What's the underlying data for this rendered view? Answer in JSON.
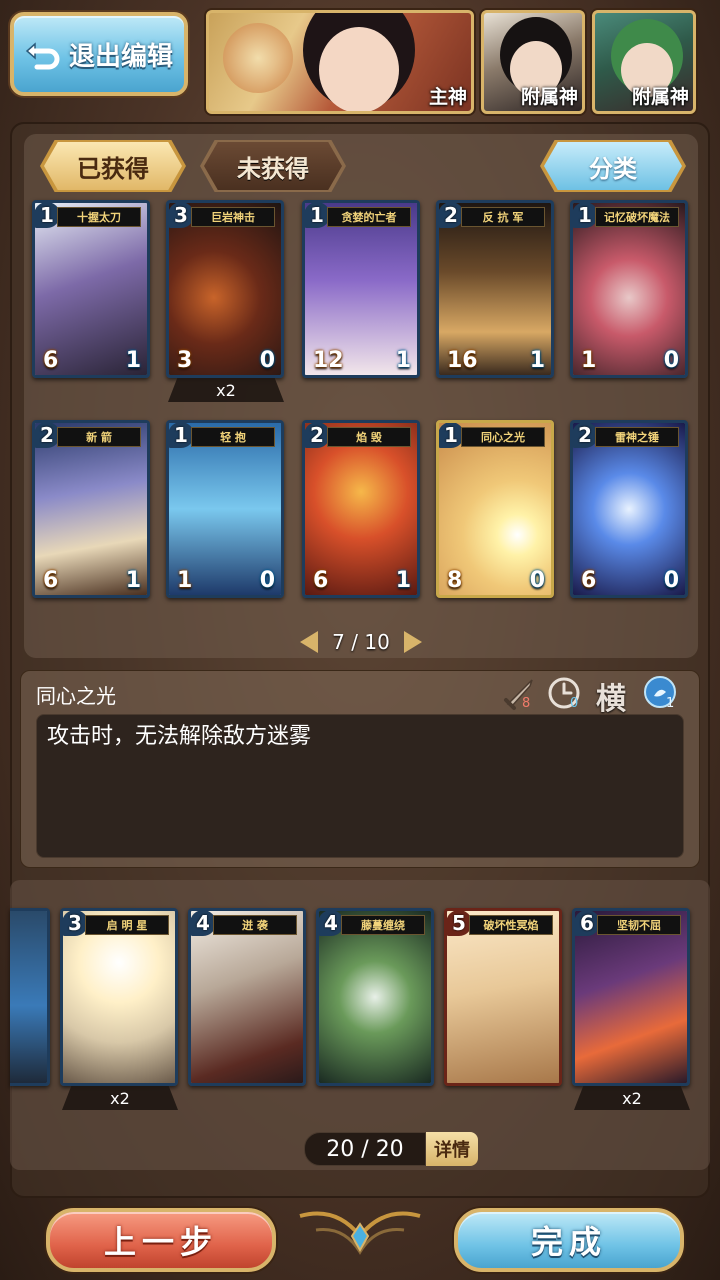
{
  "header": {
    "exit_label": "退出编辑",
    "main_deity_tag": "主神",
    "sub_deity_tag_1": "附属神",
    "sub_deity_tag_2": "附属神"
  },
  "tabs": {
    "owned": "已获得",
    "unowned": "未获得",
    "sort": "分类"
  },
  "collection": {
    "cards": [
      {
        "cost": "1",
        "title": "十握太刀",
        "atk": "6",
        "hp": "1"
      },
      {
        "cost": "3",
        "title": "巨岩神击",
        "atk": "3",
        "hp": "0",
        "count": "x2"
      },
      {
        "cost": "1",
        "title": "贪婪的亡者",
        "atk": "12",
        "hp": "1"
      },
      {
        "cost": "2",
        "title": "反 抗 军",
        "atk": "16",
        "hp": "1"
      },
      {
        "cost": "1",
        "title": "记忆破坏魔法",
        "atk": "1",
        "hp": "0"
      },
      {
        "cost": "2",
        "title": "新 箭",
        "atk": "6",
        "hp": "1"
      },
      {
        "cost": "1",
        "title": "轻 抱",
        "atk": "1",
        "hp": "0"
      },
      {
        "cost": "2",
        "title": "焰 毁",
        "atk": "6",
        "hp": "1"
      },
      {
        "cost": "1",
        "title": "同心之光",
        "atk": "8",
        "hp": "0"
      },
      {
        "cost": "2",
        "title": "雷神之锤",
        "atk": "6",
        "hp": "0"
      }
    ],
    "page_current": "7",
    "page_sep": "/",
    "page_total": "10"
  },
  "detail": {
    "name": "同心之光",
    "attack_stat": "8",
    "time_stat": "0",
    "orientation": "横",
    "element_stat": "1",
    "description": "攻击时，无法解除敌方迷雾"
  },
  "deck": {
    "cards": [
      {
        "cost": "3",
        "title": "启 明 星",
        "count": "x2"
      },
      {
        "cost": "4",
        "title": "迸 袭"
      },
      {
        "cost": "4",
        "title": "藤蔓缠绕"
      },
      {
        "cost": "5",
        "title": "破坏性冥焰"
      },
      {
        "cost": "6",
        "title": "坚韧不屈",
        "count": "x2"
      }
    ],
    "counter": "20 / 20",
    "details_label": "详情"
  },
  "footer": {
    "prev_label": "上一步",
    "done_label": "完成"
  },
  "colors": {
    "gold_border": "#d8b46a",
    "blue_button": "#6fc3e6",
    "red_button": "#e0634a",
    "card_frame": "#1e3c5c"
  }
}
